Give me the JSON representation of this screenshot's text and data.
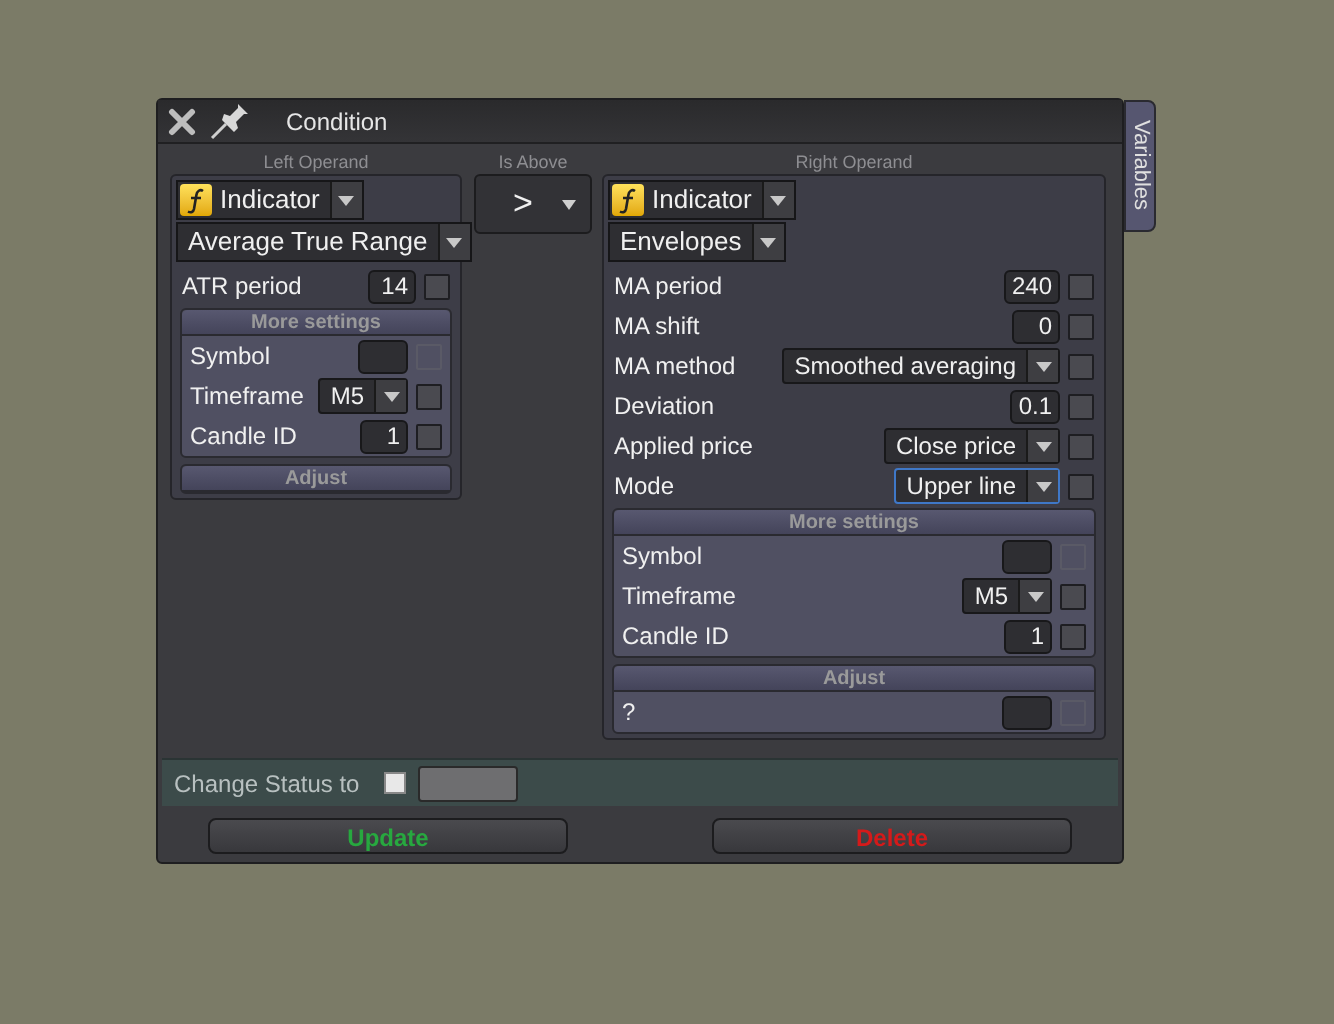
{
  "window": {
    "title": "Condition"
  },
  "side_tab": {
    "label": "Variables"
  },
  "left_operand": {
    "heading": "Left Operand",
    "type": {
      "label": "Indicator"
    },
    "indicator": {
      "value": "Average True Range"
    },
    "params": [
      {
        "kind": "number",
        "label": "ATR period",
        "value": "14",
        "checked": false,
        "disabled": false
      }
    ],
    "more_settings": {
      "heading": "More settings",
      "params": [
        {
          "kind": "text",
          "label": "Symbol",
          "checked": false,
          "disabled": true
        },
        {
          "kind": "dropdown",
          "label": "Timeframe",
          "value": "M5",
          "checked": false,
          "disabled": false
        },
        {
          "kind": "number",
          "label": "Candle ID",
          "value": "1",
          "checked": false,
          "disabled": false
        }
      ]
    },
    "adjust": {
      "heading": "Adjust"
    }
  },
  "comparison": {
    "heading": "Is Above",
    "value": ">"
  },
  "right_operand": {
    "heading": "Right Operand",
    "type": {
      "label": "Indicator"
    },
    "indicator": {
      "value": "Envelopes"
    },
    "params": [
      {
        "kind": "number",
        "label": "MA period",
        "value": "240",
        "checked": false,
        "disabled": false,
        "focused": false
      },
      {
        "kind": "number",
        "label": "MA shift",
        "value": "0",
        "checked": false,
        "disabled": false,
        "focused": false
      },
      {
        "kind": "dropdown",
        "label": "MA method",
        "value": "Smoothed averaging",
        "checked": false,
        "disabled": false,
        "focused": false
      },
      {
        "kind": "number",
        "label": "Deviation",
        "value": "0.1",
        "checked": false,
        "disabled": false,
        "focused": false
      },
      {
        "kind": "dropdown",
        "label": "Applied price",
        "value": "Close price",
        "checked": false,
        "disabled": false,
        "focused": false
      },
      {
        "kind": "dropdown",
        "label": "Mode",
        "value": "Upper line",
        "checked": false,
        "disabled": false,
        "focused": true
      }
    ],
    "more_settings": {
      "heading": "More settings",
      "params": [
        {
          "kind": "text",
          "label": "Symbol",
          "checked": false,
          "disabled": true
        },
        {
          "kind": "dropdown",
          "label": "Timeframe",
          "value": "M5",
          "checked": false,
          "disabled": false
        },
        {
          "kind": "number",
          "label": "Candle ID",
          "value": "1",
          "checked": false,
          "disabled": false
        }
      ]
    },
    "adjust": {
      "heading": "Adjust",
      "params": [
        {
          "kind": "text",
          "label": "?",
          "checked": false,
          "disabled": true
        }
      ]
    }
  },
  "status": {
    "label": "Change Status to",
    "checked": false
  },
  "buttons": [
    {
      "kind": "update",
      "label": "Update"
    },
    {
      "kind": "delete",
      "label": "Delete"
    }
  ]
}
